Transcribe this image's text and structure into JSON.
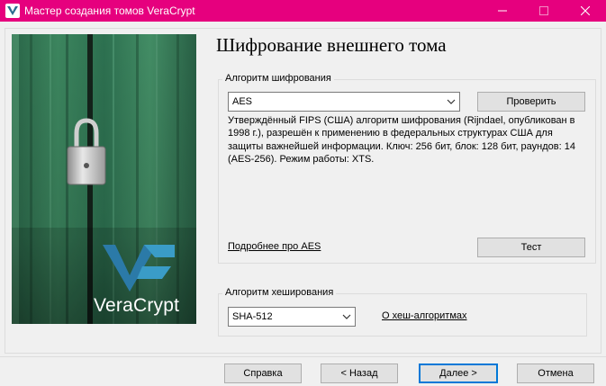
{
  "window": {
    "title": "Мастер создания томов VeraCrypt",
    "controls": {
      "minimize": "—",
      "maximize": "☐",
      "close": "✕"
    }
  },
  "branding": {
    "product_name": "VeraCrypt",
    "logo_icon": "veracrypt-logo-icon",
    "accent_color": "#e6007e"
  },
  "page": {
    "title": "Шифрование внешнего тома"
  },
  "encryption": {
    "group_label": "Алгоритм шифрования",
    "selected": "AES",
    "verify_button": "Проверить",
    "description": "Утверждённый FIPS (США) алгоритм шифрования (Rijndael, опубликован в 1998 г.), разрешён к применению в федеральных структурах США для защиты важнейшей информации. Ключ: 256 бит, блок: 128 бит, раундов: 14 (AES-256). Режим работы: XTS.",
    "more_link": "Подробнее про AES",
    "test_button": "Тест"
  },
  "hash": {
    "group_label": "Алгоритм хеширования",
    "selected": "SHA-512",
    "about_link": "О хеш-алгоритмах"
  },
  "footer": {
    "help": "Справка",
    "back": "< Назад",
    "next": "Далее >",
    "cancel": "Отмена"
  }
}
